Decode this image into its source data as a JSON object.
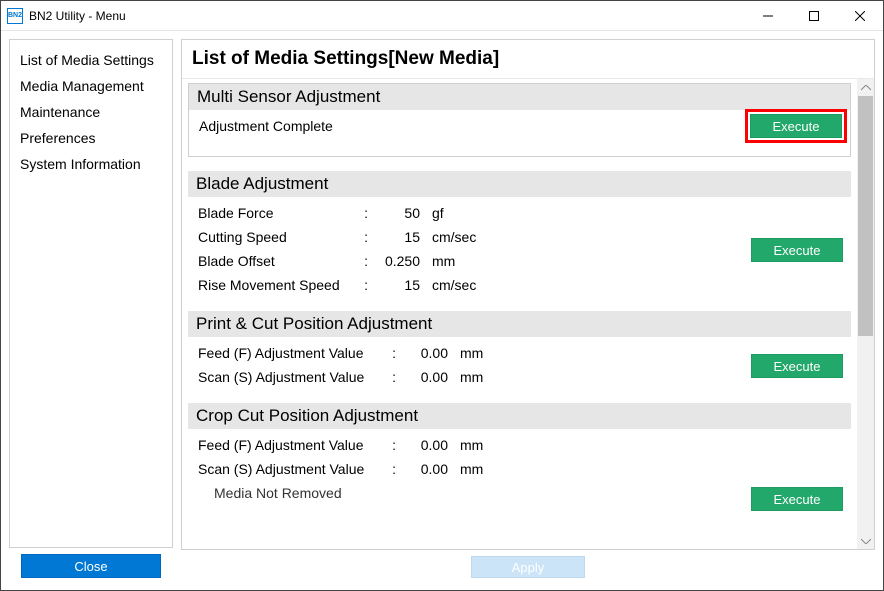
{
  "window": {
    "title": "BN2 Utility - Menu",
    "app_icon_text": "BN2"
  },
  "sidebar": {
    "items": [
      "List of Media Settings",
      "Media Management",
      "Maintenance",
      "Preferences",
      "System Information"
    ],
    "close_label": "Close"
  },
  "page": {
    "title": "List of Media Settings[New Media]"
  },
  "sections": {
    "multi_sensor": {
      "title": "Multi Sensor Adjustment",
      "status": "Adjustment Complete",
      "execute": "Execute"
    },
    "blade": {
      "title": "Blade Adjustment",
      "rows": [
        {
          "label": "Blade Force",
          "value": "50",
          "unit": "gf"
        },
        {
          "label": "Cutting Speed",
          "value": "15",
          "unit": "cm/sec"
        },
        {
          "label": "Blade Offset",
          "value": "0.250",
          "unit": "mm"
        },
        {
          "label": "Rise Movement Speed",
          "value": "15",
          "unit": "cm/sec"
        }
      ],
      "execute": "Execute"
    },
    "print_cut": {
      "title": "Print & Cut Position Adjustment",
      "rows": [
        {
          "label": "Feed (F) Adjustment Value",
          "value": "0.00",
          "unit": "mm"
        },
        {
          "label": "Scan (S) Adjustment Value",
          "value": "0.00",
          "unit": "mm"
        }
      ],
      "execute": "Execute"
    },
    "crop_cut": {
      "title": "Crop Cut Position Adjustment",
      "rows": [
        {
          "label": "Feed (F) Adjustment Value",
          "value": "0.00",
          "unit": "mm"
        },
        {
          "label": "Scan (S) Adjustment Value",
          "value": "0.00",
          "unit": "mm"
        }
      ],
      "note": "Media Not Removed",
      "execute": "Execute"
    }
  },
  "footer": {
    "apply_label": "Apply"
  }
}
